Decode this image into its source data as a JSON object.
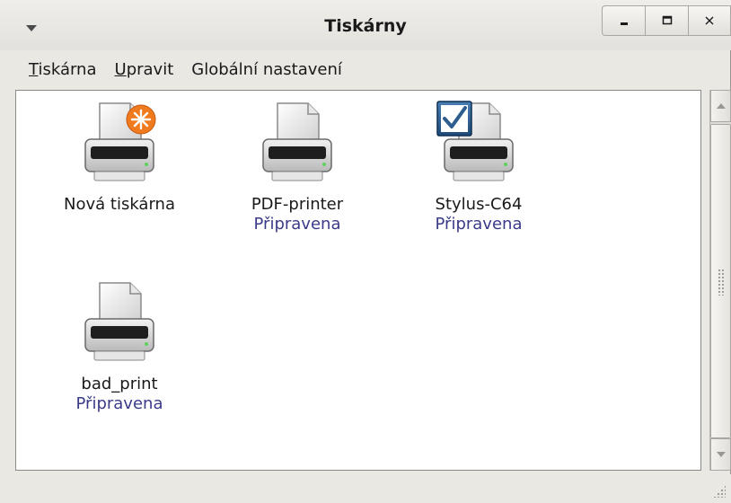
{
  "window": {
    "title": "Tiskárny"
  },
  "menubar": {
    "items": [
      {
        "mnemonic": "T",
        "rest": "iskárna"
      },
      {
        "mnemonic": "U",
        "rest": "pravit"
      },
      {
        "label": "Globální nastavení"
      }
    ]
  },
  "printers": [
    {
      "name": "Nová tiskárna",
      "state": "",
      "icon": "new-printer-icon"
    },
    {
      "name": "PDF-printer",
      "state": "Připravena",
      "icon": "printer-icon"
    },
    {
      "name": "Stylus-C64",
      "state": "Připravena",
      "icon": "default-printer-icon"
    },
    {
      "name": "bad_print",
      "state": "Připravena",
      "icon": "printer-icon"
    }
  ],
  "colors": {
    "state_text": "#3a3a8a",
    "new_badge": "#f07a1e",
    "default_badge": "#2e5e8e"
  }
}
